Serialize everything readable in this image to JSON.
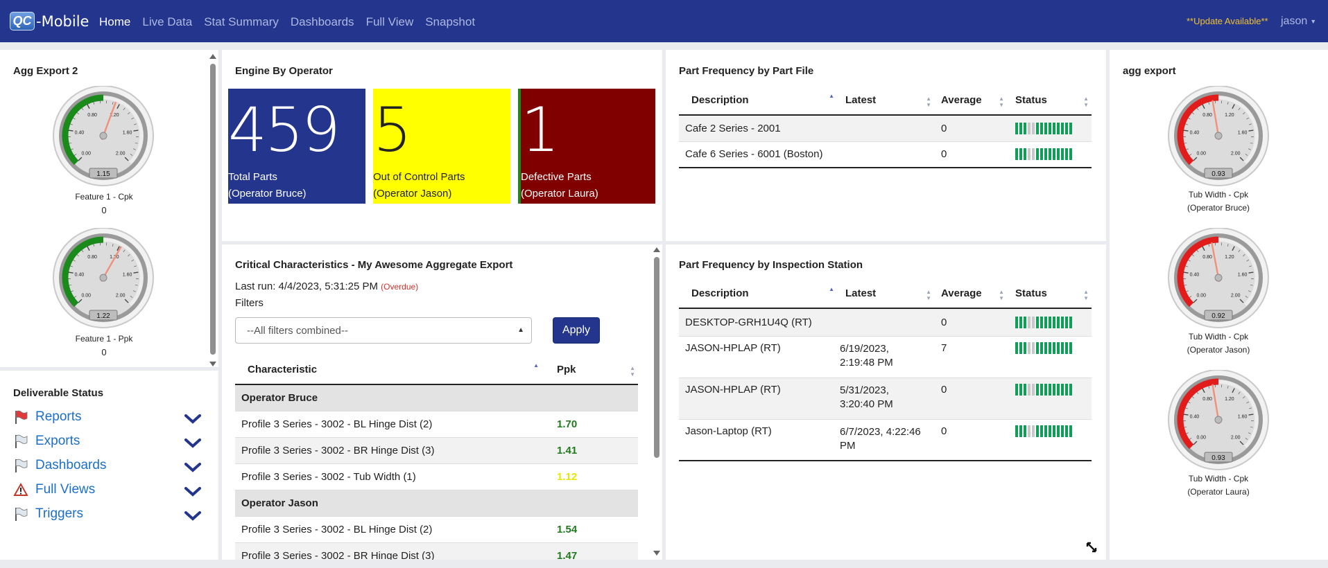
{
  "nav": {
    "logo_mark": "QC",
    "logo_text": "-Mobile",
    "links": [
      "Home",
      "Live Data",
      "Stat Summary",
      "Dashboards",
      "Full View",
      "Snapshot"
    ],
    "update": "**Update Available**",
    "user": "jason"
  },
  "agg_export_2": {
    "title": "Agg Export 2",
    "gauges": [
      {
        "label": "Feature 1 - Cpk",
        "value": "0",
        "readout": "1.15",
        "ticks": [
          "0.00",
          "0.40",
          "0.80",
          "1.20",
          "1.60",
          "2.00"
        ]
      },
      {
        "label": "Feature 1 - Ppk",
        "value": "0",
        "readout": "1.22",
        "ticks": [
          "0.00",
          "0.40",
          "0.80",
          "1.20",
          "1.60",
          "2.00"
        ]
      }
    ]
  },
  "deliverables": {
    "title": "Deliverable Status",
    "items": [
      {
        "label": "Reports",
        "icon": "red-flag-icon"
      },
      {
        "label": "Exports",
        "icon": "flag-icon"
      },
      {
        "label": "Dashboards",
        "icon": "flag-icon"
      },
      {
        "label": "Full Views",
        "icon": "warning-icon"
      },
      {
        "label": "Triggers",
        "icon": "flag-icon"
      }
    ]
  },
  "engine": {
    "title": "Engine By Operator",
    "tiles": [
      {
        "num": "459",
        "line1": "Total Parts",
        "line2": "(Operator Bruce)",
        "color": "#23358c"
      },
      {
        "num": "5",
        "line1": "Out of Control Parts",
        "line2": "(Operator Jason)",
        "color": "#ffff00"
      },
      {
        "num": "1",
        "line1": "Defective Parts",
        "line2": "(Operator Laura)",
        "color": "#800000"
      }
    ]
  },
  "part_freq_file": {
    "title": "Part Frequency by Part File",
    "headers": [
      "Description",
      "Latest",
      "Average",
      "Status"
    ],
    "rows": [
      {
        "desc": "Cafe 2 Series - 2001",
        "latest": "",
        "avg": "0"
      },
      {
        "desc": "Cafe 6 Series - 6001 (Boston)",
        "latest": "",
        "avg": "0"
      }
    ]
  },
  "part_freq_station": {
    "title": "Part Frequency by Inspection Station",
    "headers": [
      "Description",
      "Latest",
      "Average",
      "Status"
    ],
    "rows": [
      {
        "desc": "DESKTOP-GRH1U4Q (RT)",
        "latest1": "",
        "latest2": "",
        "avg": "0"
      },
      {
        "desc": "JASON-HPLAP (RT)",
        "latest1": "6/19/2023,",
        "latest2": "2:19:48 PM",
        "avg": "7"
      },
      {
        "desc": "JASON-HPLAP (RT)",
        "latest1": "5/31/2023,",
        "latest2": "3:20:40 PM",
        "avg": "0"
      },
      {
        "desc": "Jason-Laptop (RT)",
        "latest1": "6/7/2023, 4:22:46",
        "latest2": "PM",
        "avg": "0"
      }
    ]
  },
  "critical": {
    "title": "Critical Characteristics - My Awesome Aggregate Export",
    "last_run_label": "Last run: 4/4/2023, 5:31:25 PM",
    "overdue": "(Overdue)",
    "filters_label": "Filters",
    "filter_value": "--All filters combined--",
    "apply": "Apply",
    "headers": [
      "Characteristic",
      "Ppk"
    ],
    "groups": [
      {
        "name": "Operator Bruce",
        "rows": [
          {
            "name": "Profile 3 Series - 3002 - BL Hinge Dist (2)",
            "ppk": "1.70",
            "color": "#1f7a1f"
          },
          {
            "name": "Profile 3 Series - 3002 - BR Hinge Dist (3)",
            "ppk": "1.41",
            "color": "#1f7a1f"
          },
          {
            "name": "Profile 3 Series - 3002 - Tub Width (1)",
            "ppk": "1.12",
            "color": "#e6e600"
          }
        ]
      },
      {
        "name": "Operator Jason",
        "rows": [
          {
            "name": "Profile 3 Series - 3002 - BL Hinge Dist (2)",
            "ppk": "1.54",
            "color": "#1f7a1f"
          },
          {
            "name": "Profile 3 Series - 3002 - BR Hinge Dist (3)",
            "ppk": "1.47",
            "color": "#1f7a1f"
          }
        ]
      }
    ]
  },
  "agg_export": {
    "title": "agg export",
    "gauges": [
      {
        "line1": "Tub Width - Cpk",
        "line2": "(Operator Bruce)",
        "readout": "0.93",
        "ticks": [
          "0.00",
          "0.40",
          "0.80",
          "1.20",
          "1.60",
          "2.00"
        ]
      },
      {
        "line1": "Tub Width - Cpk",
        "line2": "(Operator Jason)",
        "readout": "0.92",
        "ticks": [
          "0.00",
          "0.40",
          "0.80",
          "1.20",
          "1.60",
          "2.00"
        ]
      },
      {
        "line1": "Tub Width - Cpk",
        "line2": "(Operator Laura)",
        "readout": "0.93",
        "ticks": [
          "0.00",
          "0.40",
          "0.80",
          "1.20",
          "1.60",
          "2.00"
        ]
      }
    ]
  },
  "colors": {
    "nav": "#23358c",
    "ok": "#0f9d58",
    "zone_green": "#1a8a1a",
    "zone_red": "#e21b1b"
  }
}
